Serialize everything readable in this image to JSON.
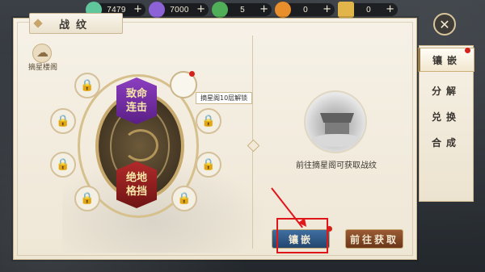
{
  "resources": [
    {
      "name": "jade",
      "icon": "jade-icon",
      "value": "7479",
      "color": "#5fc79b"
    },
    {
      "name": "crystal",
      "icon": "crystal-icon",
      "value": "7000",
      "color": "#8d62d6"
    },
    {
      "name": "leaf",
      "icon": "leaf-icon",
      "value": "5",
      "color": "#4fae57"
    },
    {
      "name": "orb",
      "icon": "orb-icon",
      "value": "0",
      "color": "#e88f2b"
    },
    {
      "name": "scroll",
      "icon": "scroll-icon",
      "value": "0",
      "color": "#e2b54a"
    }
  ],
  "panel": {
    "title": "战纹",
    "badge_label": "摘星楼阁",
    "tooltip": "摘星阁10层解锁",
    "hint": "前往摘星阁可获取战纹"
  },
  "gems": {
    "top": {
      "line1": "致命",
      "line2": "连击",
      "color": "#7c34b1"
    },
    "bottom": {
      "line1": "绝地",
      "line2": "格挡",
      "color": "#9b2323"
    }
  },
  "buttons": {
    "inlay": "镶嵌",
    "go_obtain": "前往获取"
  },
  "tabs": [
    {
      "label": "镶嵌",
      "active": true
    },
    {
      "label": "分解",
      "active": false
    },
    {
      "label": "兑换",
      "active": false
    },
    {
      "label": "合成",
      "active": false
    }
  ]
}
